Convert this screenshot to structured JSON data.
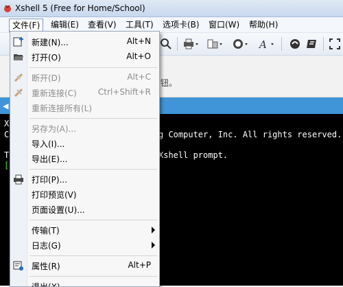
{
  "window": {
    "title": "Xshell 5 (Free for Home/School)"
  },
  "menubar": {
    "items": [
      {
        "label": "文件(F)"
      },
      {
        "label": "编辑(E)"
      },
      {
        "label": "查看(V)"
      },
      {
        "label": "工具(T)"
      },
      {
        "label": "选项卡(B)"
      },
      {
        "label": "窗口(W)"
      },
      {
        "label": "帮助(H)"
      }
    ]
  },
  "infobar": {
    "text_fragment": "钮。"
  },
  "terminal": {
    "lines": [
      {
        "text": "X"
      },
      {
        "text": "C"
      },
      {
        "text": "g Computer, Inc. All rights reserved."
      },
      {
        "text": "T"
      },
      {
        "text": "Xshell prompt."
      },
      {
        "text": "["
      }
    ]
  },
  "file_menu": {
    "items": [
      {
        "label": "新建(N)...",
        "shortcut": "Alt+N",
        "icon": "new-session-icon",
        "enabled": true
      },
      {
        "label": "打开(O)",
        "shortcut": "Alt+O",
        "icon": "open-folder-icon",
        "enabled": true
      },
      {
        "label": "断开(D)",
        "shortcut": "Alt+C",
        "icon": "disconnect-icon",
        "enabled": false
      },
      {
        "label": "重新连接(C)",
        "shortcut": "Ctrl+Shift+R",
        "icon": "reconnect-icon",
        "enabled": false
      },
      {
        "label": "重新连接所有(L)",
        "shortcut": "",
        "enabled": false
      },
      {
        "label": "另存为(A)...",
        "shortcut": "",
        "enabled": false
      },
      {
        "label": "导入(I)...",
        "shortcut": "",
        "enabled": true
      },
      {
        "label": "导出(E)...",
        "shortcut": "",
        "enabled": true
      },
      {
        "label": "打印(P)...",
        "shortcut": "",
        "icon": "printer-icon",
        "enabled": true
      },
      {
        "label": "打印预览(V)",
        "shortcut": "",
        "enabled": true
      },
      {
        "label": "页面设置(U)...",
        "shortcut": "",
        "enabled": true
      },
      {
        "label": "传输(T)",
        "shortcut": "",
        "submenu": true,
        "enabled": true
      },
      {
        "label": "日志(G)",
        "shortcut": "",
        "submenu": true,
        "enabled": true
      },
      {
        "label": "属性(R)",
        "shortcut": "Alt+P",
        "icon": "properties-icon",
        "enabled": true
      },
      {
        "label": "退出(X)",
        "shortcut": "",
        "enabled": true
      }
    ]
  },
  "colors": {
    "accent": "#3f95d8",
    "prompt_green": "#3ee23e"
  }
}
